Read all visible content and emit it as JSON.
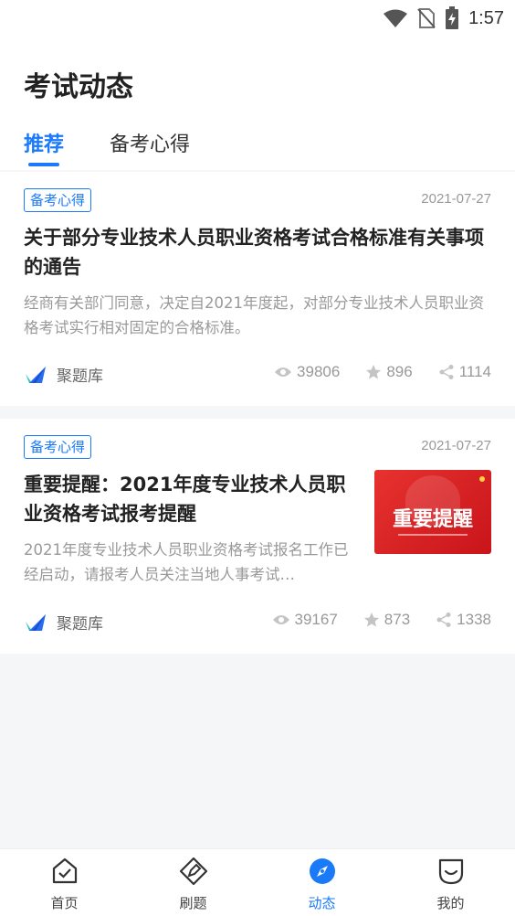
{
  "status_bar": {
    "time": "1:57"
  },
  "header": {
    "title": "考试动态",
    "tabs": [
      {
        "label": "推荐",
        "active": true
      },
      {
        "label": "备考心得",
        "active": false
      }
    ]
  },
  "articles": [
    {
      "tag": "备考心得",
      "date": "2021-07-27",
      "title": "关于部分专业技术人员职业资格考试合格标准有关事项的通告",
      "summary": "经商有关部门同意，决定自2021年度起，对部分专业技术人员职业资格考试实行相对固定的合格标准。",
      "source": "聚题库",
      "views": "39806",
      "stars": "896",
      "shares": "1114"
    },
    {
      "tag": "备考心得",
      "date": "2021-07-27",
      "title": "重要提醒：2021年度专业技术人员职业资格考试报考提醒",
      "summary": "2021年度专业技术人员职业资格考试报名工作已经启动，请报考人员关注当地人事考试…",
      "thumbnail_text": "重要提醒",
      "source": "聚题库",
      "views": "39167",
      "stars": "873",
      "shares": "1338"
    }
  ],
  "bottom_nav": [
    {
      "label": "首页",
      "icon": "home-check-icon",
      "active": false
    },
    {
      "label": "刷题",
      "icon": "pen-icon",
      "active": false
    },
    {
      "label": "动态",
      "icon": "compass-icon",
      "active": true
    },
    {
      "label": "我的",
      "icon": "profile-icon",
      "active": false
    }
  ],
  "colors": {
    "accent": "#1a7af8",
    "muted": "#999999",
    "thumbnail_red": "#d8202a"
  }
}
